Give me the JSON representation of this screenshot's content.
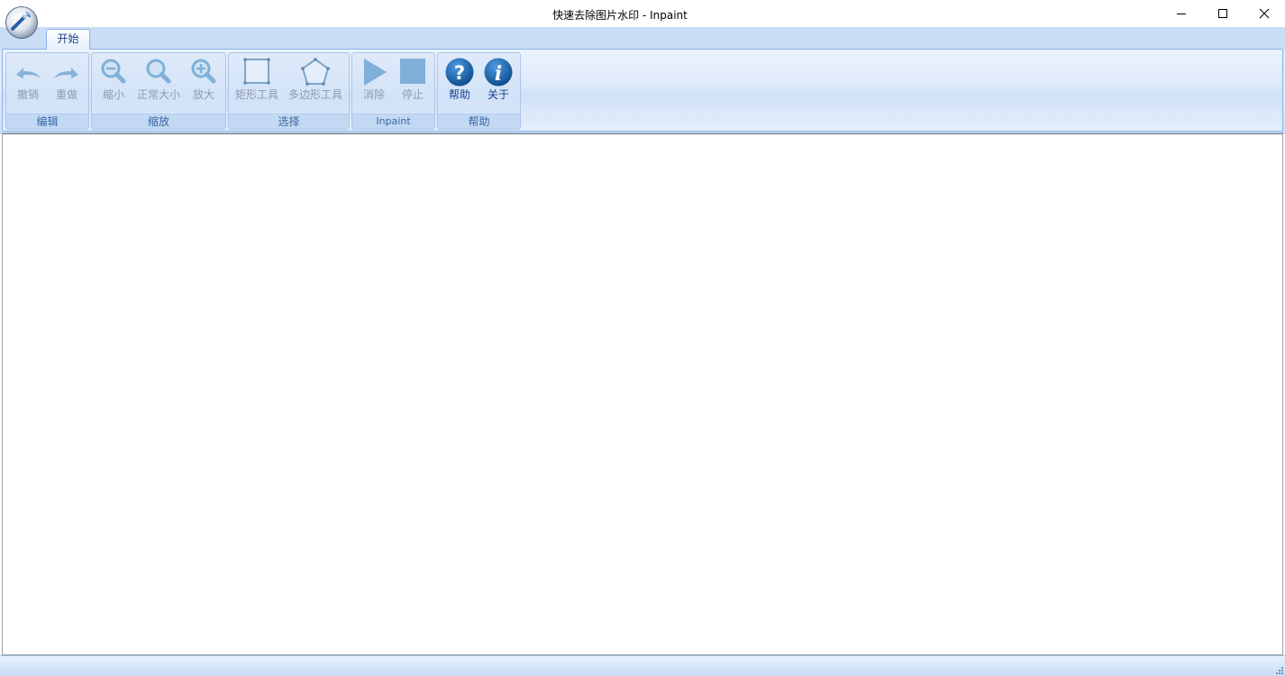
{
  "window": {
    "title": "快速去除图片水印 - Inpaint",
    "controls": {
      "minimize_icon": "minimize-icon",
      "maximize_icon": "maximize-icon",
      "close_icon": "close-icon"
    }
  },
  "ribbon": {
    "tabs": [
      {
        "label": "开始",
        "active": true
      }
    ],
    "groups": [
      {
        "label": "编辑",
        "buttons": [
          {
            "label": "撤销",
            "icon": "undo-icon",
            "enabled": false
          },
          {
            "label": "重做",
            "icon": "redo-icon",
            "enabled": false
          }
        ]
      },
      {
        "label": "缩放",
        "buttons": [
          {
            "label": "缩小",
            "icon": "zoom-out-icon",
            "enabled": false
          },
          {
            "label": "正常大小",
            "icon": "zoom-normal-icon",
            "enabled": false
          },
          {
            "label": "放大",
            "icon": "zoom-in-icon",
            "enabled": false
          }
        ]
      },
      {
        "label": "选择",
        "buttons": [
          {
            "label": "矩形工具",
            "icon": "rectangle-tool-icon",
            "enabled": false
          },
          {
            "label": "多边形工具",
            "icon": "polygon-tool-icon",
            "enabled": false
          }
        ]
      },
      {
        "label": "Inpaint",
        "buttons": [
          {
            "label": "消除",
            "icon": "play-icon",
            "enabled": false
          },
          {
            "label": "停止",
            "icon": "stop-icon",
            "enabled": false
          }
        ]
      },
      {
        "label": "帮助",
        "buttons": [
          {
            "label": "帮助",
            "icon": "help-icon",
            "enabled": true
          },
          {
            "label": "关于",
            "icon": "info-icon",
            "enabled": true
          }
        ]
      }
    ]
  },
  "colors": {
    "accent": "#15428b",
    "ribbon_background": "#dfe9f8",
    "disabled_icon": "#7fb0d8",
    "help_icon": "#1a63a8"
  }
}
